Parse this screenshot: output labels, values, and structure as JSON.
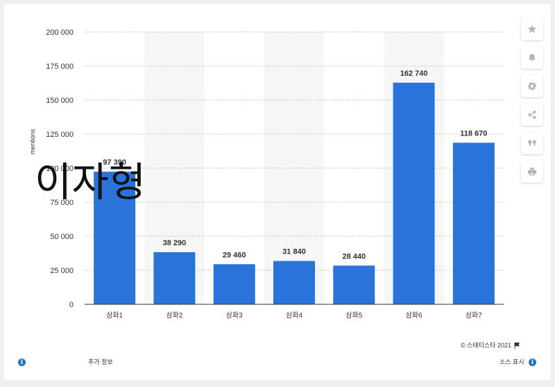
{
  "chart_data": {
    "type": "bar",
    "categories": [
      "삼화1",
      "삼화2",
      "삼화3",
      "삼화4",
      "삼화5",
      "삼화6",
      "삼화7"
    ],
    "values": [
      97390,
      38290,
      29460,
      31840,
      28440,
      162740,
      118670
    ],
    "data_labels": [
      "97 390",
      "38 290",
      "29 460",
      "31 840",
      "28 440",
      "162 740",
      "118 670"
    ],
    "yticks": [
      0,
      25000,
      50000,
      75000,
      100000,
      125000,
      150000,
      175000,
      200000
    ],
    "ytick_labels": [
      "0",
      "25 000",
      "50 000",
      "75 000",
      "100 000",
      "125 000",
      "150 000",
      "175 000",
      "200 000"
    ],
    "ylim": [
      0,
      200000
    ],
    "ylabel": "mentions",
    "grid": true,
    "bar_color": "#2a73db",
    "band_color": "#f6f6f6"
  },
  "overlay": {
    "text": "이자형"
  },
  "footer": {
    "copyright": "©  스태티스타 2021",
    "more_info": "추가 정보",
    "show_source": "소스 표시"
  },
  "toolbar": {
    "icons": [
      "star-icon",
      "bell-icon",
      "gear-icon",
      "share-icon",
      "quote-icon",
      "print-icon"
    ]
  },
  "colors": {
    "accent": "#1a73c9"
  }
}
